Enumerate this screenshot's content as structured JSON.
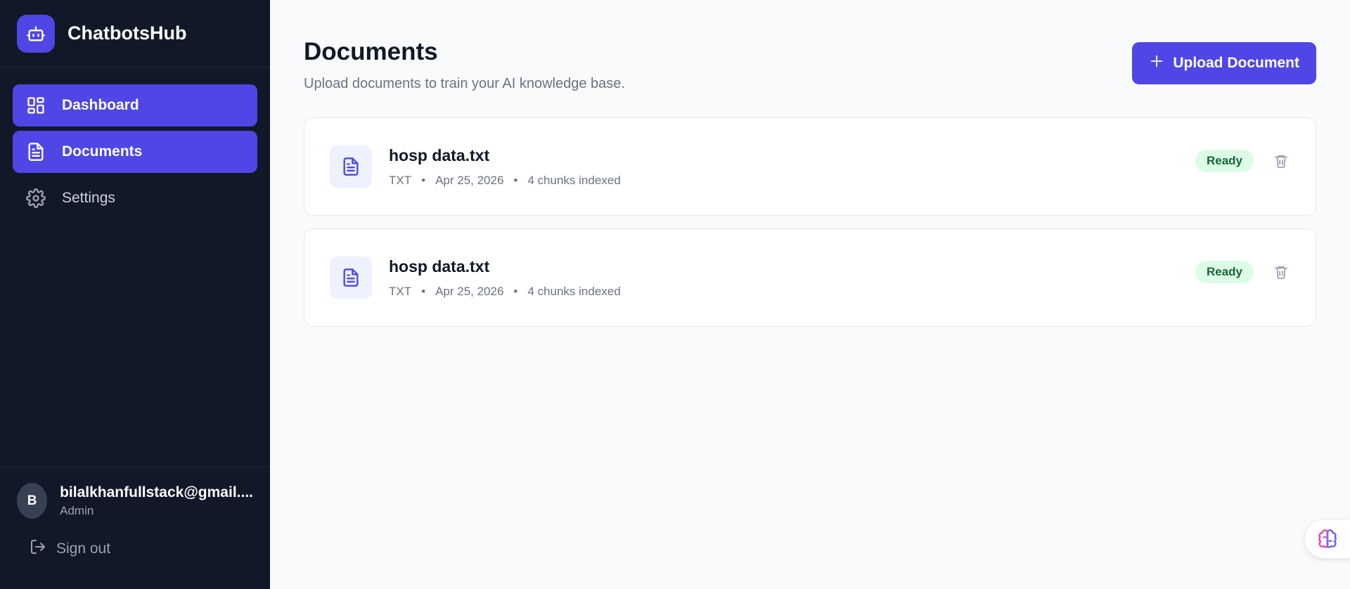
{
  "brand": {
    "name": "ChatbotsHub",
    "icon": "robot-icon",
    "accent": "#4f46e5"
  },
  "sidebar": {
    "items": [
      {
        "label": "Dashboard",
        "icon": "dashboard-icon",
        "active": true
      },
      {
        "label": "Documents",
        "icon": "document-icon",
        "active": true
      },
      {
        "label": "Settings",
        "icon": "gear-icon",
        "active": false
      }
    ],
    "user": {
      "initial": "B",
      "email": "bilalkhanfullstack@gmail....",
      "role": "Admin"
    },
    "signout_label": "Sign out"
  },
  "main": {
    "title": "Documents",
    "subtitle": "Upload documents to train your AI knowledge base.",
    "upload_label": "Upload Document",
    "documents": [
      {
        "name": "hosp data.txt",
        "type": "TXT",
        "date": "Apr 25, 2026",
        "chunks": "4 chunks indexed",
        "status": "Ready"
      },
      {
        "name": "hosp data.txt",
        "type": "TXT",
        "date": "Apr 25, 2026",
        "chunks": "4 chunks indexed",
        "status": "Ready"
      }
    ]
  },
  "colors": {
    "sidebar_bg": "#111827",
    "accent": "#4f46e5",
    "ready_bg": "#dcfce7",
    "ready_text": "#166534"
  }
}
